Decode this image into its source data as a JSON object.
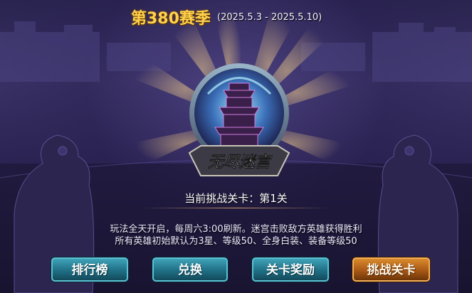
{
  "season": {
    "title": "第380赛季",
    "dates": "(2025.5.3 - 2025.5.10)"
  },
  "emblem": {
    "name_text": "无尽迷宫"
  },
  "current_level": "当前挑战关卡：第1关",
  "description": {
    "line1": "玩法全天开启，每周六3:00刷新。迷宫击败敌方英雄获得胜利",
    "line2": "所有英雄初始默认为3星、等级50、全身白装、装备等级50"
  },
  "buttons": {
    "ranking": "排行榜",
    "exchange": "兑换",
    "stage_rewards": "关卡奖励",
    "challenge": "挑战关卡"
  },
  "colors": {
    "title_gold": "#ffd14d",
    "button_teal": "#1f6f85",
    "button_orange": "#a85816"
  },
  "icons": [
    "tower-emblem-icon",
    "guardian-lion-statue-left",
    "guardian-lion-statue-right"
  ]
}
